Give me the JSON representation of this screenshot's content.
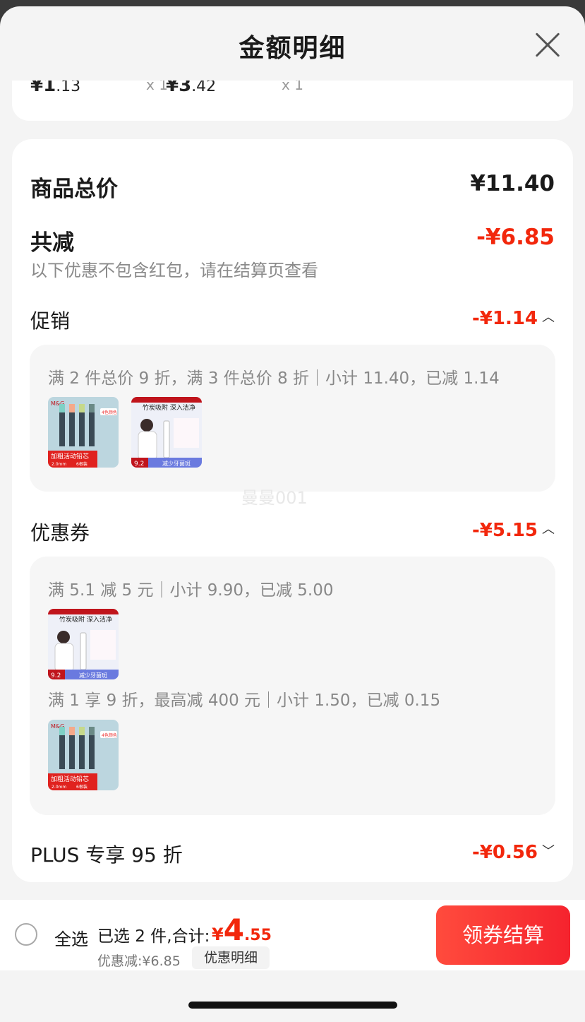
{
  "header": {
    "title": "金额明细"
  },
  "top_items": [
    {
      "price_symbol": "¥",
      "price_int": "1",
      "price_dec": ".13",
      "qty": "x 1"
    },
    {
      "price_symbol": "¥",
      "price_int": "3",
      "price_dec": ".42",
      "qty": "x 1"
    }
  ],
  "summary": {
    "total_label": "商品总价",
    "total_value": "¥11.40",
    "reduce_label": "共减",
    "reduce_value": "-¥6.85",
    "note": "以下优惠不包含红包，请在结算页查看"
  },
  "promotion": {
    "label": "促销",
    "value": "-¥1.14",
    "rule": "满 2 件总价 9 折，满 3 件总价 8 折｜小计 11.40，已减 1.14",
    "thumbs": [
      {
        "name": "pencil-lead",
        "title": "加粗活动铅芯",
        "sub1": "2.0mm",
        "sub2": "6根装",
        "brand": "M&G",
        "tag": "4色颜色"
      },
      {
        "name": "toothpaste",
        "title": "竹炭吸附 深入洁净",
        "sub1": "9.2",
        "sub2": "减少牙菌斑"
      }
    ]
  },
  "coupon": {
    "label": "优惠券",
    "value": "-¥5.15",
    "rule1": "满 5.1 减 5 元｜小计 9.90，已减 5.00",
    "rule2": "满 1 享 9 折，最高减 400 元｜小计 1.50，已减 0.15",
    "thumb1": {
      "title": "竹炭吸附 深入洁净",
      "sub1": "9.2",
      "sub2": "减少牙菌斑"
    },
    "thumb2": {
      "title": "加粗活动铅芯",
      "sub1": "2.0mm",
      "sub2": "6根装",
      "brand": "M&G",
      "tag": "4色颜色"
    }
  },
  "plus": {
    "label": "PLUS 专享 95 折",
    "value": "-¥0.56"
  },
  "watermark": "曼曼001",
  "bottom": {
    "select_all": "全选",
    "selected": "已选 2 件,合计:",
    "total_symbol": "¥",
    "total_int": "4",
    "total_dec": ".55",
    "discount": "优惠减:¥6.85",
    "detail_btn": "优惠明细",
    "checkout": "领券结算"
  },
  "colors": {
    "accent": "#f2270c",
    "background": "#f4f4f4",
    "card": "#ffffff"
  }
}
